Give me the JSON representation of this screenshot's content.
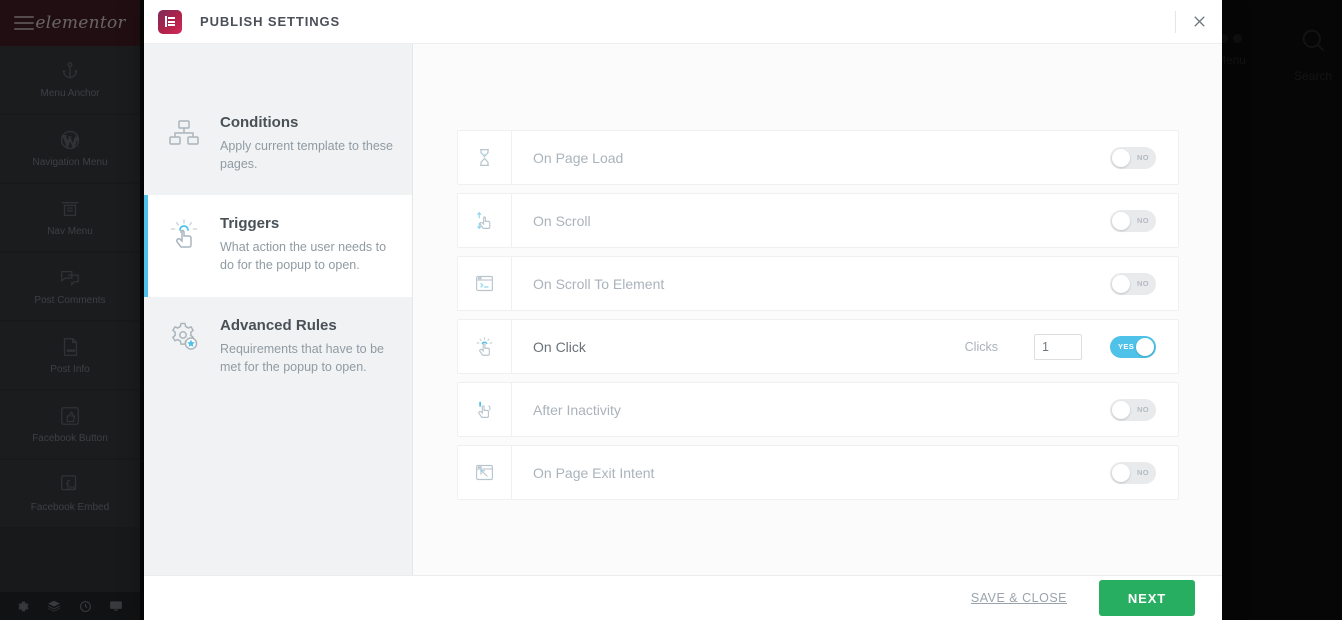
{
  "background": {
    "panel": {
      "menu_icon": "hamburger-icon",
      "brand": "elementor",
      "widgets": [
        {
          "label": "Menu Anchor",
          "icon": "anchor-icon"
        },
        {
          "label": "Navigation Menu",
          "icon": "wordpress-icon"
        },
        {
          "label": "Nav Menu",
          "icon": "nav-menu-icon"
        },
        {
          "label": "Post Comments",
          "icon": "comments-icon"
        },
        {
          "label": "Post Info",
          "icon": "document-icon"
        },
        {
          "label": "Facebook Button",
          "icon": "thumbs-up-icon"
        },
        {
          "label": "Facebook Embed",
          "icon": "facebook-embed-icon"
        }
      ],
      "bottom_tools": [
        "settings-gear-icon",
        "layers-icon",
        "history-icon",
        "preview-monitor-icon"
      ]
    },
    "canvas_nav": {
      "menu_label": "Menu",
      "search_label": "Search"
    }
  },
  "modal": {
    "logo_icon": "elementor-logo-icon",
    "title": "PUBLISH SETTINGS",
    "close_icon": "close-icon",
    "sidebar": {
      "items": [
        {
          "id": "conditions",
          "title": "Conditions",
          "desc": "Apply current template to these pages.",
          "icon": "sitemap-icon",
          "active": false
        },
        {
          "id": "triggers",
          "title": "Triggers",
          "desc": "What action the user needs to do for the popup to open.",
          "icon": "click-hand-icon",
          "active": true
        },
        {
          "id": "advanced-rules",
          "title": "Advanced Rules",
          "desc": "Requirements that have to be met for the popup to open.",
          "icon": "gear-star-icon",
          "active": false
        }
      ]
    },
    "triggers": [
      {
        "id": "on-page-load",
        "label": "On Page Load",
        "icon": "hourglass-icon",
        "enabled": false,
        "toggle_text": "NO"
      },
      {
        "id": "on-scroll",
        "label": "On Scroll",
        "icon": "scroll-hand-icon",
        "enabled": false,
        "toggle_text": "NO"
      },
      {
        "id": "on-scroll-to-element",
        "label": "On Scroll To Element",
        "icon": "browser-code-icon",
        "enabled": false,
        "toggle_text": "NO"
      },
      {
        "id": "on-click",
        "label": "On Click",
        "icon": "click-hand-icon",
        "enabled": true,
        "toggle_text": "YES",
        "field_label": "Clicks",
        "field_value": "1"
      },
      {
        "id": "after-inactivity",
        "label": "After Inactivity",
        "icon": "idle-hand-icon",
        "enabled": false,
        "toggle_text": "NO"
      },
      {
        "id": "on-page-exit-intent",
        "label": "On Page Exit Intent",
        "icon": "exit-intent-icon",
        "enabled": false,
        "toggle_text": "NO"
      }
    ],
    "footer": {
      "save_close_label": "SAVE & CLOSE",
      "next_label": "NEXT"
    }
  },
  "colors": {
    "accent_cyan": "#4fc2e9",
    "next_green": "#27ae60",
    "title_gray": "#4b4f58",
    "muted_gray": "#aab3bb"
  }
}
